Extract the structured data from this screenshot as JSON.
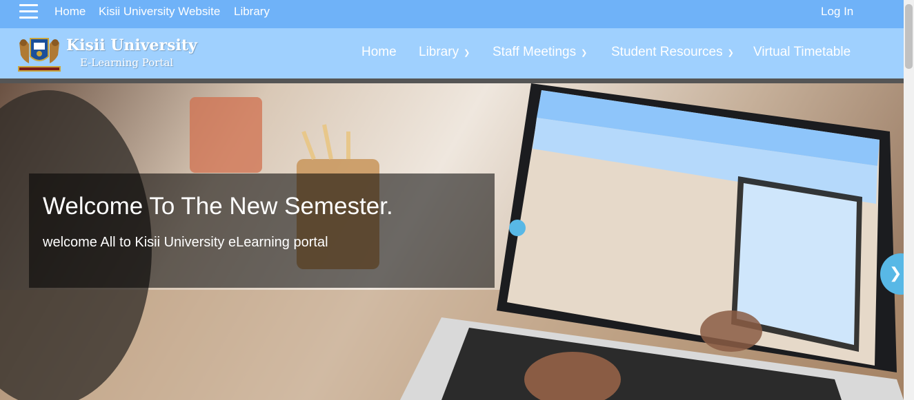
{
  "topbar": {
    "links": [
      "Home",
      "Kisii University Website",
      "Library"
    ],
    "login": "Log In"
  },
  "brand": {
    "name": "Kisii University",
    "subtitle": "E-Learning Portal"
  },
  "nav": {
    "items": [
      "Home",
      "Library",
      "Staff Meetings",
      "Student Resources",
      "Virtual Timetable"
    ]
  },
  "hero": {
    "title": "Welcome To The New Semester.",
    "subtitle": "welcome All to Kisii University eLearning portal"
  },
  "icons": {
    "menu": "hamburger-icon",
    "caret": "chevron-down-icon",
    "next": "chevron-right-icon"
  },
  "colors": {
    "topbar": "#6fb2f8",
    "navbar": "#9fd0fe",
    "accent": "#58b8e6"
  }
}
